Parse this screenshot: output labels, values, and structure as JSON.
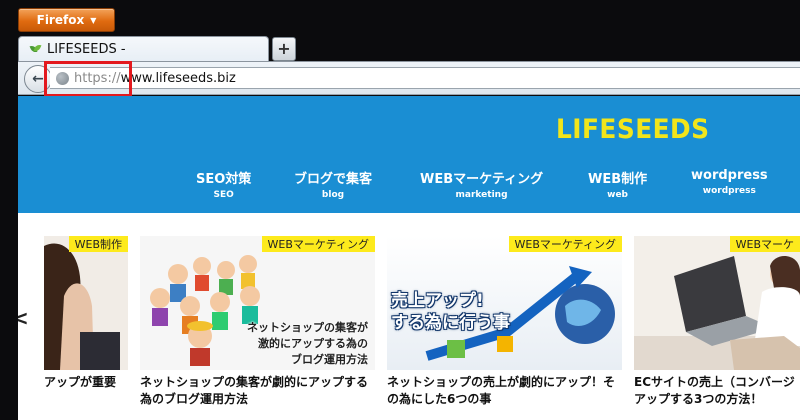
{
  "browser": {
    "menu_button": "Firefox",
    "tab_title": "LIFESEEDS -",
    "new_tab_symbol": "+",
    "back_symbol": "←",
    "url_protocol": "https://",
    "url_host": "www.lifeseeds.biz",
    "highlight_color": "#e3191e"
  },
  "site": {
    "logo": "LIFESEEDS",
    "header_color": "#1a8ed3",
    "logo_color": "#f2e51b",
    "menu": [
      {
        "label": "SEO対策",
        "sub": "SEO"
      },
      {
        "label": "ブログで集客",
        "sub": "blog"
      },
      {
        "label": "WEBマーケティング",
        "sub": "marketing"
      },
      {
        "label": "WEB制作",
        "sub": "web"
      },
      {
        "label": "wordpress",
        "sub": "wordpress"
      }
    ],
    "slider_prev": "<",
    "cards": [
      {
        "badge": "WEB制作",
        "caption": "アップが重要"
      },
      {
        "badge": "WEBマーケティング",
        "image_text": [
          "ネットショップの集客が",
          "激的にアップする為の",
          "ブログ運用方法"
        ],
        "caption": "ネットショップの集客が劇的にアップする為のブログ運用方法"
      },
      {
        "badge": "WEBマーケティング",
        "image_text": [
          "売上アップ!",
          "する為に行う事"
        ],
        "caption": "ネットショップの売上が劇的にアップ！その為にした6つの事"
      },
      {
        "badge": "WEBマーケ",
        "caption": "ECサイトの売上（コンバージ アップする3つの方法！"
      }
    ]
  }
}
